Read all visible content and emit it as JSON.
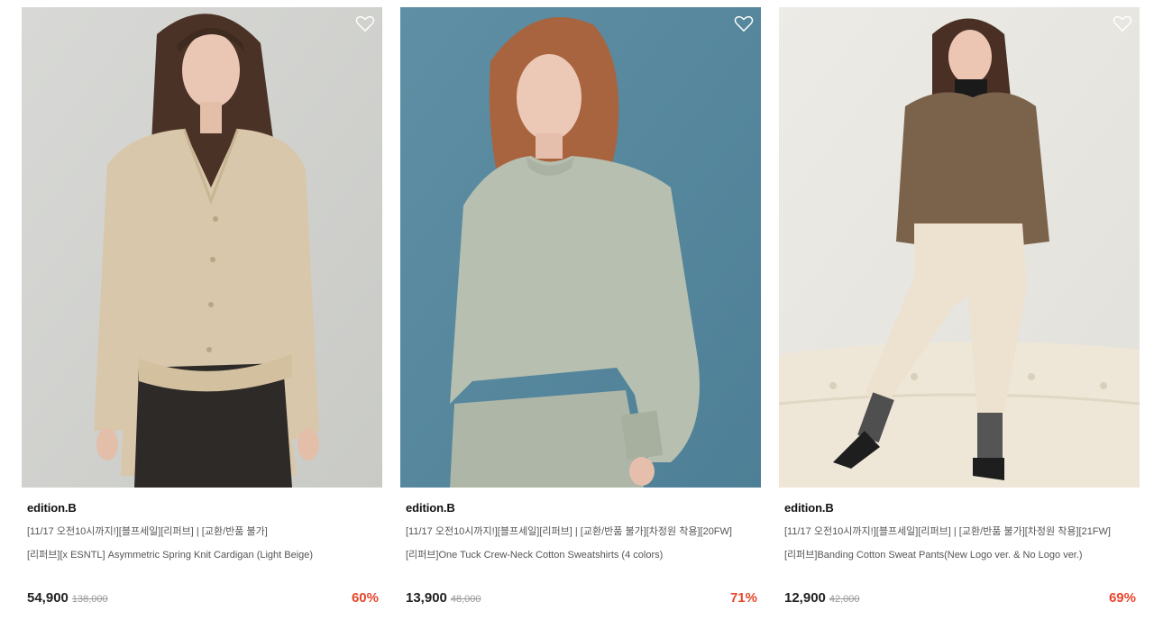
{
  "products": [
    {
      "brand": "edition.B",
      "tags": "[11/17 오전10시까지!][블프세일][리퍼브] | [교환/반품 불가]",
      "title": "[리퍼브][x ESNTL] Asymmetric Spring Knit Cardigan (Light Beige)",
      "price": "54,900",
      "original_price": "138,000",
      "discount": "60%",
      "image_icon": "model-beige-cardigan-photo"
    },
    {
      "brand": "edition.B",
      "tags": "[11/17 오전10시까지!][블프세일][리퍼브] | [교환/반품 불가][차정원 착용][20FW]",
      "title": "[리퍼브]One Tuck Crew-Neck Cotton Sweatshirts (4 colors)",
      "price": "13,900",
      "original_price": "48,000",
      "discount": "71%",
      "image_icon": "model-sage-sweatshirt-photo"
    },
    {
      "brand": "edition.B",
      "tags": "[11/17 오전10시까지!][블프세일][리퍼브] | [교환/반품 불가][차정원 착용][21FW]",
      "title": "[리퍼브]Banding Cotton Sweat Pants(New Logo ver. & No Logo ver.)",
      "price": "12,900",
      "original_price": "42,000",
      "discount": "69%",
      "image_icon": "model-cream-sweatpants-photo"
    }
  ],
  "colors": {
    "discount": "#e8452c",
    "text": "#222222",
    "muted": "#555555",
    "strike": "#999999"
  },
  "icons": {
    "wishlist": "heart-outline-icon"
  }
}
